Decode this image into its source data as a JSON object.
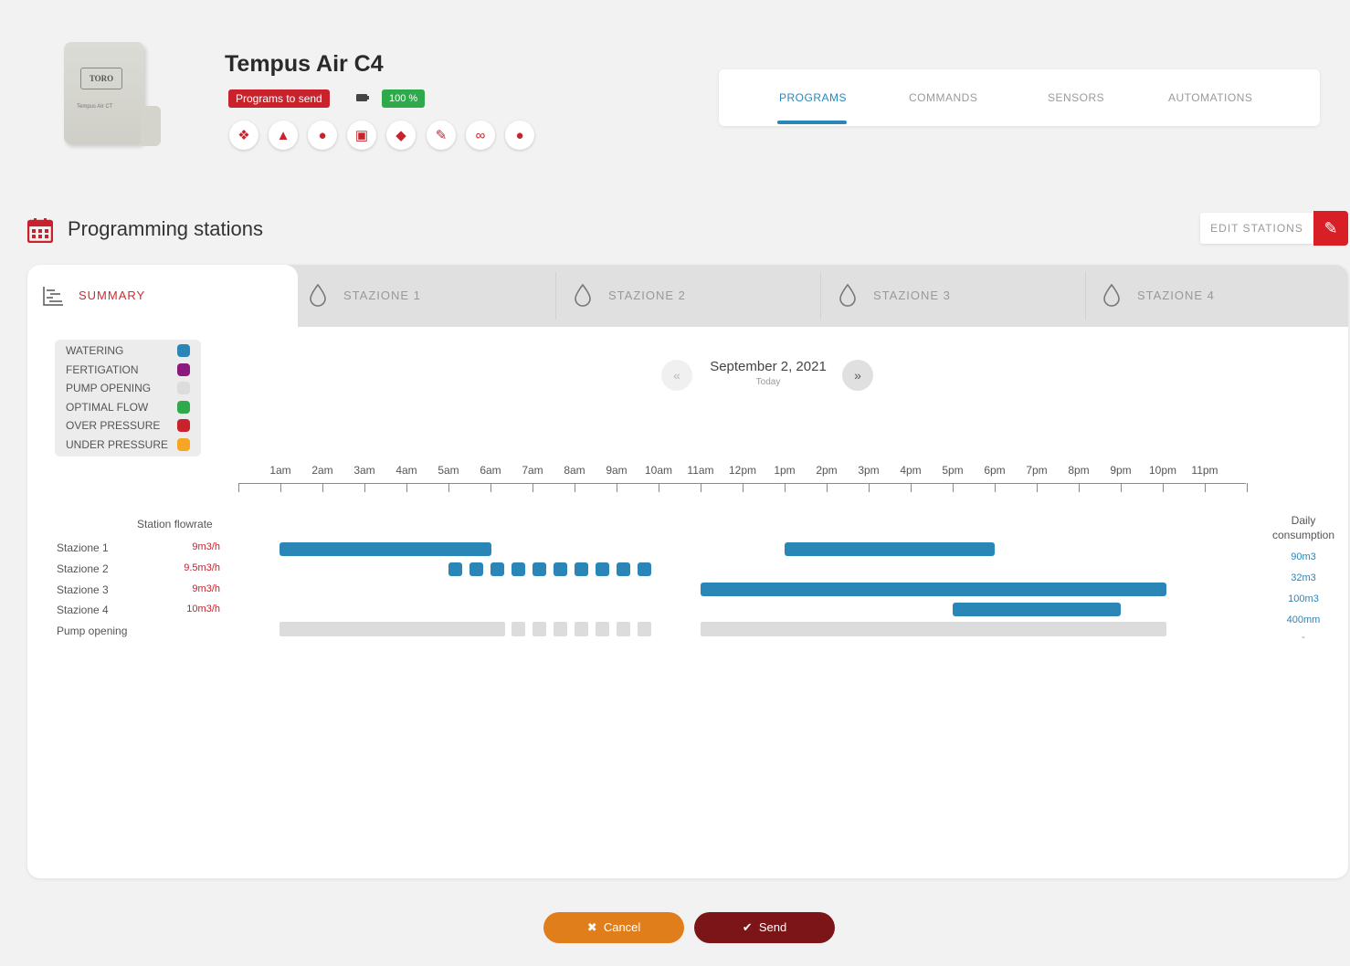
{
  "device": {
    "name": "Tempus Air C4",
    "image_logo": "TORO",
    "image_model": "Tempus Air CT",
    "status_badge": "Programs to send",
    "battery": "100 %",
    "action_icons": [
      "info-icon",
      "network-icon",
      "globe-icon",
      "save-icon",
      "tag-icon",
      "pencil-icon",
      "unlink-icon",
      "drop-icon"
    ]
  },
  "nav": {
    "tabs": [
      {
        "label": "PROGRAMS",
        "active": true
      },
      {
        "label": "COMMANDS",
        "active": false
      },
      {
        "label": "SENSORS",
        "active": false
      },
      {
        "label": "AUTOMATIONS",
        "active": false
      }
    ]
  },
  "section": {
    "title": "Programming stations",
    "edit_label": "EDIT STATIONS"
  },
  "station_tabs": [
    {
      "label": "SUMMARY",
      "active": true
    },
    {
      "label": "STAZIONE 1",
      "active": false
    },
    {
      "label": "STAZIONE 2",
      "active": false
    },
    {
      "label": "STAZIONE 3",
      "active": false
    },
    {
      "label": "STAZIONE 4",
      "active": false
    }
  ],
  "legend": [
    {
      "label": "WATERING",
      "color": "#2b86b8"
    },
    {
      "label": "FERTIGATION",
      "color": "#8a1a7e"
    },
    {
      "label": "PUMP OPENING",
      "color": "#dcdcdc"
    },
    {
      "label": "OPTIMAL FLOW",
      "color": "#2eaa4a"
    },
    {
      "label": "OVER PRESSURE",
      "color": "#c8222d"
    },
    {
      "label": "UNDER PRESSURE",
      "color": "#f5a623"
    }
  ],
  "date": {
    "prev": "«",
    "next": "»",
    "main": "September 2, 2021",
    "sub": "Today"
  },
  "hours": [
    "1am",
    "2am",
    "3am",
    "4am",
    "5am",
    "6am",
    "7am",
    "8am",
    "9am",
    "10am",
    "11am",
    "12pm",
    "1pm",
    "2pm",
    "3pm",
    "4pm",
    "5pm",
    "6pm",
    "7pm",
    "8pm",
    "9pm",
    "10pm",
    "11pm"
  ],
  "schedule": {
    "flowrate_header": "Station flowrate",
    "consumption_header": "Daily consumption",
    "rows": [
      {
        "name": "Stazione 1",
        "flowrate": "9m3/h",
        "consumption": "90m3"
      },
      {
        "name": "Stazione 2",
        "flowrate": "9.5m3/h",
        "consumption": "32m3"
      },
      {
        "name": "Stazione 3",
        "flowrate": "9m3/h",
        "consumption": "100m3"
      },
      {
        "name": "Stazione 4",
        "flowrate": "10m3/h",
        "consumption": "400mm"
      },
      {
        "name": "Pump opening",
        "flowrate": "",
        "consumption": "-"
      }
    ]
  },
  "footer": {
    "cancel": "Cancel",
    "send": "Send"
  }
}
